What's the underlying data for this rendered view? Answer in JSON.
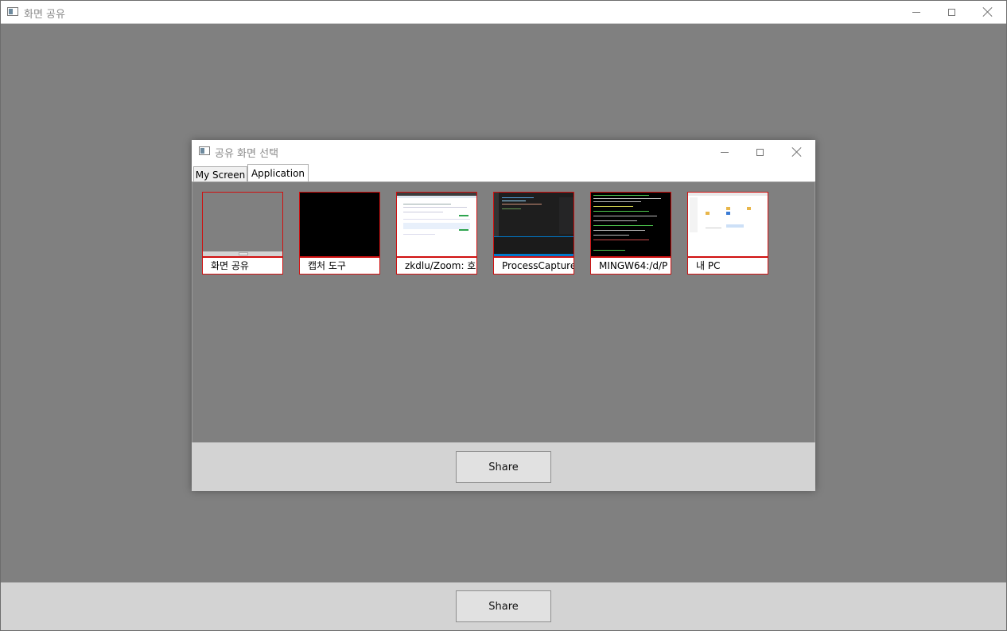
{
  "main_window": {
    "title": "화면 공유",
    "share_label": "Share"
  },
  "dialog": {
    "title": "공유 화면 선택",
    "tabs": [
      {
        "label": "My Screen",
        "active": false
      },
      {
        "label": "Application",
        "active": true
      }
    ],
    "thumbnails": [
      {
        "label": "화면 공유"
      },
      {
        "label": "캡처 도구"
      },
      {
        "label": "zkdlu/Zoom: 호"
      },
      {
        "label": "ProcessCapture"
      },
      {
        "label": "MINGW64:/d/P"
      },
      {
        "label": "내 PC"
      }
    ],
    "share_label": "Share"
  },
  "colors": {
    "backdrop": "#808080",
    "footer": "#d3d3d3",
    "thumb_border": "#d01010"
  }
}
